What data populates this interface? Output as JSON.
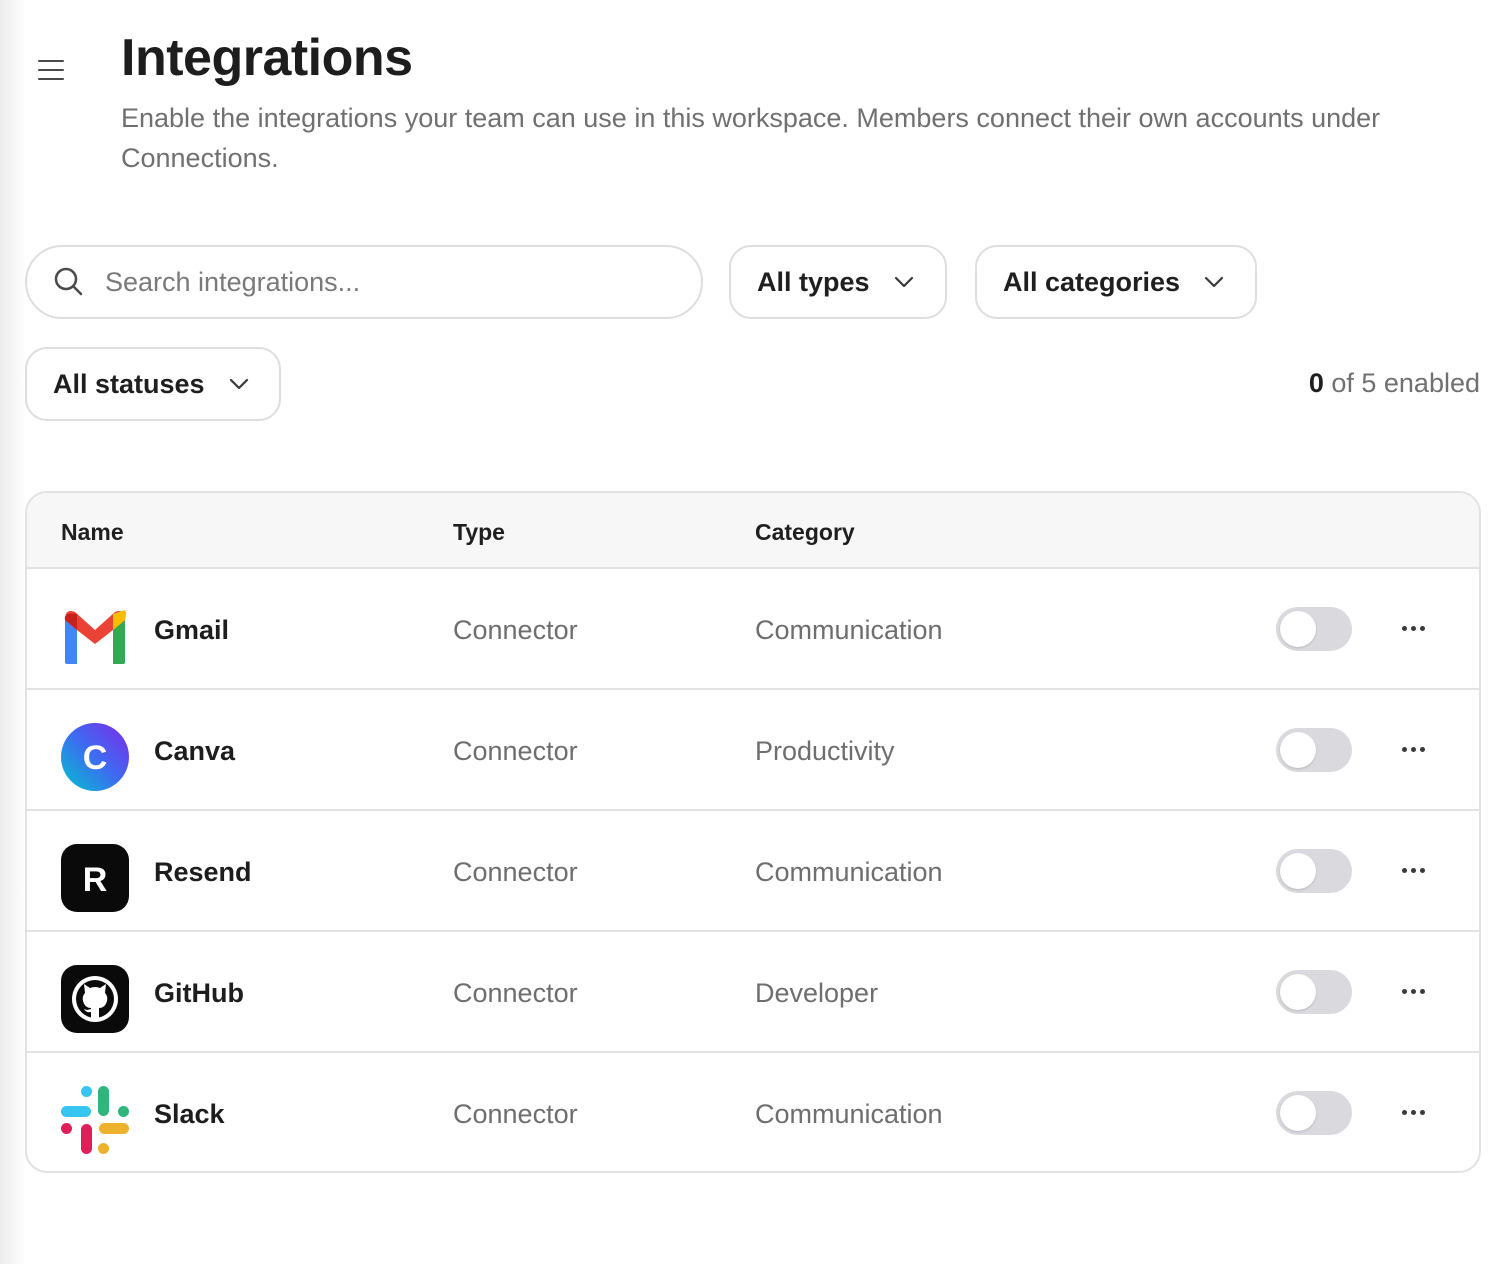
{
  "page": {
    "title": "Integrations",
    "description": "Enable the integrations your team can use in this workspace. Members connect their own accounts under Connections."
  },
  "filters": {
    "search_placeholder": "Search integrations...",
    "types_label": "All types",
    "categories_label": "All categories",
    "statuses_label": "All statuses"
  },
  "summary": {
    "enabled_count": "0",
    "enabled_suffix": "of 5 enabled"
  },
  "table": {
    "headers": {
      "name": "Name",
      "type": "Type",
      "category": "Category"
    },
    "rows": [
      {
        "name": "Gmail",
        "type": "Connector",
        "category": "Communication",
        "icon": "gmail-logo-icon",
        "enabled": false
      },
      {
        "name": "Canva",
        "type": "Connector",
        "category": "Productivity",
        "icon": "canva-logo-icon",
        "enabled": false
      },
      {
        "name": "Resend",
        "type": "Connector",
        "category": "Communication",
        "icon": "resend-logo-icon",
        "enabled": false
      },
      {
        "name": "GitHub",
        "type": "Connector",
        "category": "Developer",
        "icon": "github-logo-icon",
        "enabled": false
      },
      {
        "name": "Slack",
        "type": "Connector",
        "category": "Communication",
        "icon": "slack-logo-icon",
        "enabled": false
      }
    ]
  },
  "logo_text": {
    "canva": "C",
    "resend": "R"
  },
  "colors": {
    "toggle_off": "#d9d9de",
    "border": "#e2e2e2",
    "muted_text": "#6e6e6e"
  }
}
